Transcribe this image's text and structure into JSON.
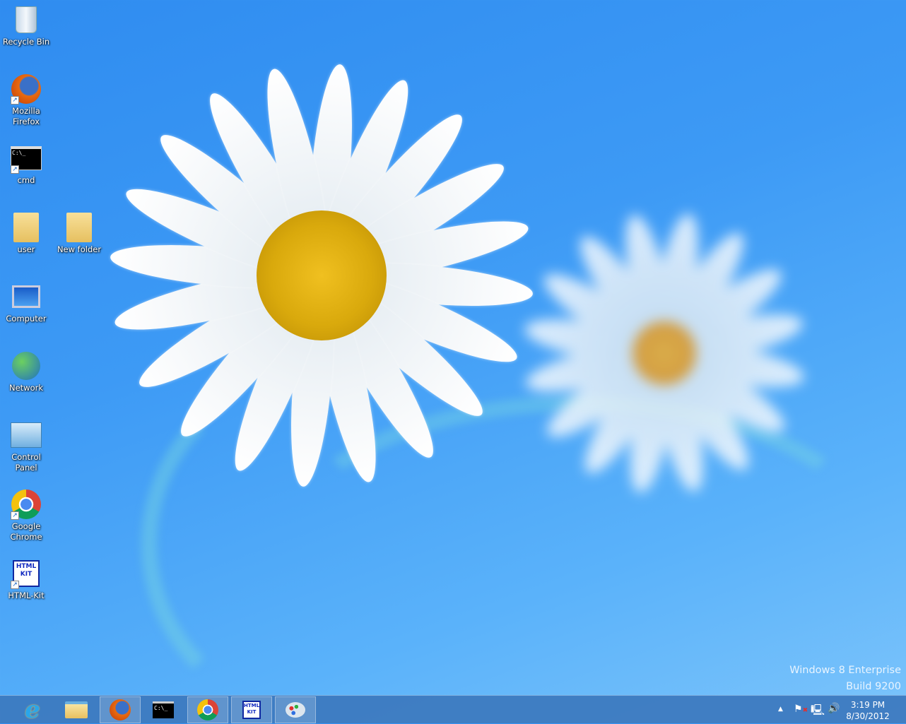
{
  "desktop": {
    "icons": [
      {
        "label": "Recycle Bin",
        "icon": "recycle-bin-icon"
      },
      {
        "label": "Mozilla Firefox",
        "icon": "firefox-icon",
        "shortcut": true
      },
      {
        "label": "cmd",
        "icon": "cmd-icon",
        "shortcut": true
      },
      {
        "label": "user",
        "icon": "user-folder-icon"
      },
      {
        "label": "New folder",
        "icon": "folder-icon"
      },
      {
        "label": "Computer",
        "icon": "computer-icon"
      },
      {
        "label": "Network",
        "icon": "network-icon"
      },
      {
        "label": "Control Panel",
        "icon": "control-panel-icon"
      },
      {
        "label": "Google Chrome",
        "icon": "chrome-icon",
        "shortcut": true
      },
      {
        "label": "HTML-Kit",
        "icon": "html-kit-icon",
        "shortcut": true
      }
    ],
    "watermark": {
      "line1": "Windows 8 Enterprise",
      "line2": "Build 9200"
    },
    "cmd_glyph": "C:\\_",
    "htmlkit_glyph": "HTML KIT"
  },
  "taskbar": {
    "buttons": [
      "Internet Explorer",
      "File Explorer",
      "Mozilla Firefox",
      "cmd",
      "Google Chrome",
      "HTML-Kit",
      "Paint"
    ],
    "tray": {
      "show_hidden": "▲",
      "time": "3:19 PM",
      "date": "8/30/2012"
    }
  },
  "colors": {
    "taskbar": "#3c78be",
    "desktop": "#3d9af5"
  }
}
